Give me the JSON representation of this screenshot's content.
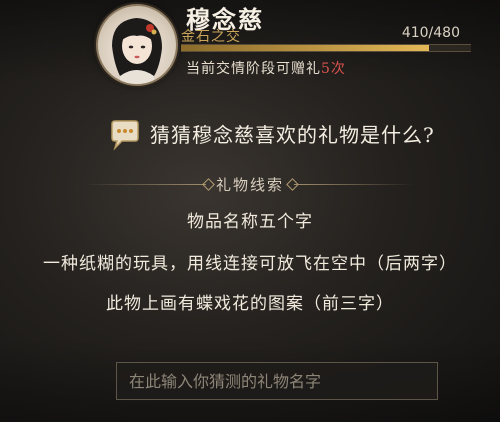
{
  "character": {
    "name": "穆念慈",
    "relationship_stage": "金石之交",
    "progress_text": "410/480",
    "progress_fraction": 0.854,
    "gift_info_prefix": "当前交情阶段可赠礼",
    "gift_count": "5次"
  },
  "quiz": {
    "question": "猜猜穆念慈喜欢的礼物是什么?",
    "clues_title": "礼物线索",
    "clues": [
      "物品名称五个字",
      "一种纸糊的玩具，用线连接可放飞在空中（后两字）",
      "此物上画有蝶戏花的图案（前三字）"
    ]
  },
  "input": {
    "placeholder": "在此输入你猜测的礼物名字",
    "value": ""
  },
  "colors": {
    "accent_gold": "#c9a45a",
    "count_red": "#d9534f"
  },
  "icons": {
    "chat": "speech-bubble-icon",
    "portrait": "character-portrait"
  }
}
